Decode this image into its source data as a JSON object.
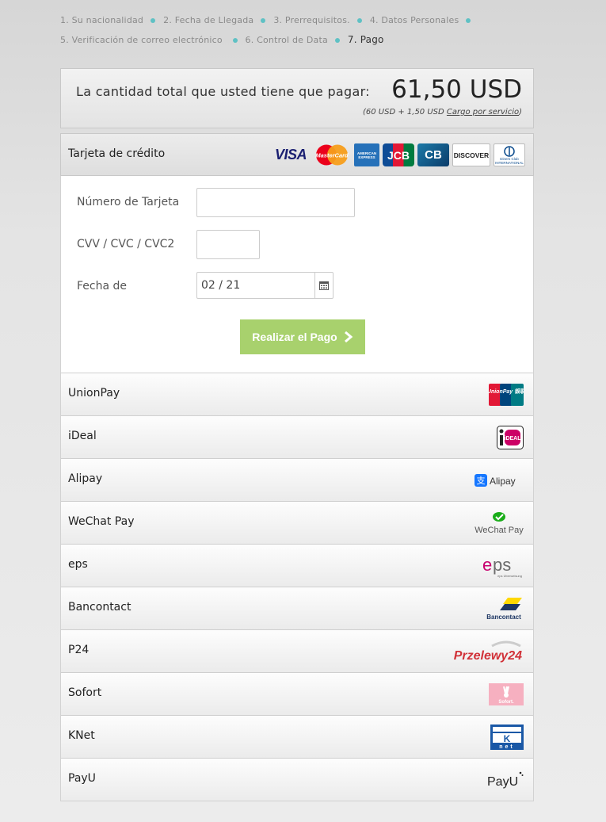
{
  "steps": [
    {
      "label": "1. Su nacionalidad"
    },
    {
      "label": "2. Fecha de Llegada"
    },
    {
      "label": "3. Prerrequisitos."
    },
    {
      "label": "4. Datos Personales"
    },
    {
      "label": "5. Verificación de correo electrónico"
    },
    {
      "label": "6. Control de Data"
    },
    {
      "label": "7. Pago"
    }
  ],
  "total": {
    "label": "La cantidad total que usted tiene que pagar:",
    "amount": "61,50 USD",
    "breakdown_prefix": "(60 USD + 1,50 USD ",
    "breakdown_link": "Cargo por servicio",
    "breakdown_suffix": ")"
  },
  "credit_card": {
    "title": "Tarjeta de crédito",
    "logos": [
      "VISA",
      "MasterCard",
      "AMERICAN EXPRESS",
      "JCB",
      "CB",
      "DISCOVER",
      "Diners Club INTERNATIONAL"
    ],
    "card_number_label": "Número de Tarjeta",
    "card_number_value": "",
    "cvv_label": "CVV / CVC / CVC2",
    "cvv_value": "",
    "date_label": "Fecha de",
    "date_value": "02 / 21",
    "pay_button": "Realizar el Pago"
  },
  "methods": [
    {
      "name": "UnionPay",
      "logo": "UnionPay 银联"
    },
    {
      "name": "iDeal",
      "logo": "iDEAL"
    },
    {
      "name": "Alipay",
      "logo": "Alipay"
    },
    {
      "name": "WeChat Pay",
      "logo": "WeChat Pay"
    },
    {
      "name": "eps",
      "logo": "eps Überweisung"
    },
    {
      "name": "Bancontact",
      "logo": "Bancontact"
    },
    {
      "name": "P24",
      "logo": "Przelewy24"
    },
    {
      "name": "Sofort",
      "logo": "Sofort."
    },
    {
      "name": "KNet",
      "logo": "net"
    },
    {
      "name": "PayU",
      "logo": "PayU"
    }
  ],
  "colors": {
    "accent_dot": "#5fc1c4",
    "pay_button": "#a8d16d"
  }
}
